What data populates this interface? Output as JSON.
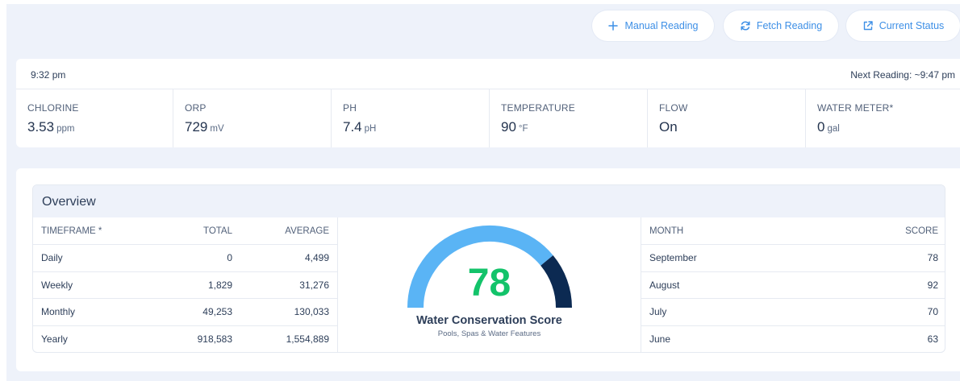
{
  "actions": {
    "manual_label": "Manual Reading",
    "fetch_label": "Fetch Reading",
    "status_label": "Current Status"
  },
  "readings": {
    "time": "9:32 pm",
    "next_reading": "Next Reading: ~9:47 pm",
    "metrics": [
      {
        "label": "CHLORINE",
        "value": "3.53",
        "unit": "ppm"
      },
      {
        "label": "ORP",
        "value": "729",
        "unit": "mV"
      },
      {
        "label": "PH",
        "value": "7.4",
        "unit": "pH"
      },
      {
        "label": "TEMPERATURE",
        "value": "90",
        "unit": "°F"
      },
      {
        "label": "FLOW",
        "value": "On",
        "unit": ""
      },
      {
        "label": "WATER METER*",
        "value": "0",
        "unit": "gal"
      }
    ]
  },
  "overview": {
    "title": "Overview",
    "timeframe_table": {
      "headers": [
        "TIMEFRAME *",
        "TOTAL",
        "AVERAGE"
      ],
      "rows": [
        [
          "Daily",
          "0",
          "4,499"
        ],
        [
          "Weekly",
          "1,829",
          "31,276"
        ],
        [
          "Monthly",
          "49,253",
          "130,033"
        ],
        [
          "Yearly",
          "918,583",
          "1,554,889"
        ]
      ]
    },
    "gauge": {
      "score": "78",
      "score_fraction": 0.78,
      "title": "Water Conservation Score",
      "subtitle": "Pools, Spas & Water Features",
      "fill_color": "#5ab4f5",
      "remaining_color": "#0c2a52",
      "score_color": "#13c36a"
    },
    "month_table": {
      "headers": [
        "MONTH",
        "SCORE"
      ],
      "rows": [
        [
          "September",
          "78"
        ],
        [
          "August",
          "92"
        ],
        [
          "July",
          "70"
        ],
        [
          "June",
          "63"
        ]
      ]
    }
  },
  "icons": {
    "manual": "plus-icon",
    "fetch": "refresh-icon",
    "status": "external-link-icon"
  }
}
